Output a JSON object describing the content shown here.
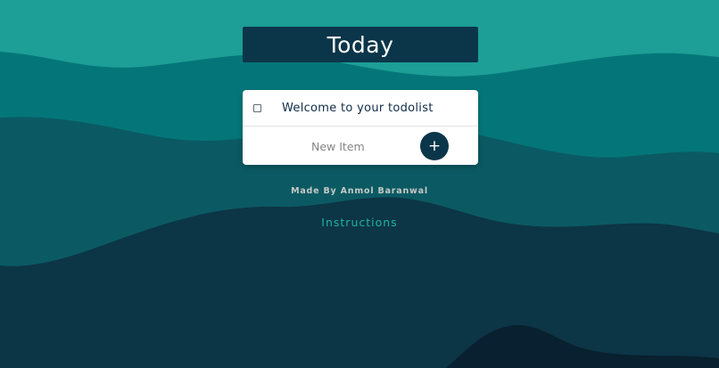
{
  "header": {
    "title": "Today"
  },
  "todo_list": {
    "items": [
      {
        "label": "Welcome to your todolist",
        "checked": false
      }
    ],
    "new_item": {
      "placeholder": "New Item",
      "value": "",
      "add_button_label": "+"
    }
  },
  "footer": {
    "credit": "Made By Anmol Baranwal",
    "instructions_link": "Instructions"
  },
  "icons": {
    "add_button_icon": "plus-icon",
    "item_checkbox": "checkbox-icon"
  },
  "colors": {
    "background_light_teal": "#1d9e96",
    "wave_teal": "#047679",
    "wave_mid": "#0b5a63",
    "wave_dark": "#0c3545",
    "wave_darkest": "#08202f",
    "accent_navy": "#0b3649",
    "instructions_link": "#21b3a4"
  }
}
